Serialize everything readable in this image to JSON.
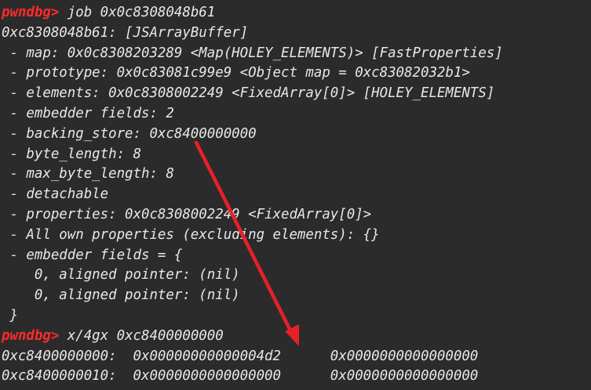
{
  "prompt_label": "pwndbg>",
  "lines": [
    {
      "kind": "prompt",
      "text": " job 0x0c8308048b61"
    },
    {
      "kind": "plain",
      "text": "0xc8308048b61: [JSArrayBuffer]"
    },
    {
      "kind": "plain",
      "text": " - map: 0x0c8308203289 <Map(HOLEY_ELEMENTS)> [FastProperties]"
    },
    {
      "kind": "plain",
      "text": " - prototype: 0x0c83081c99e9 <Object map = 0xc83082032b1>"
    },
    {
      "kind": "plain",
      "text": " - elements: 0x0c8308002249 <FixedArray[0]> [HOLEY_ELEMENTS]"
    },
    {
      "kind": "plain",
      "text": " - embedder fields: 2"
    },
    {
      "kind": "plain",
      "text": " - backing_store: 0xc8400000000"
    },
    {
      "kind": "plain",
      "text": " - byte_length: 8"
    },
    {
      "kind": "plain",
      "text": " - max_byte_length: 8"
    },
    {
      "kind": "plain",
      "text": " - detachable"
    },
    {
      "kind": "plain",
      "text": " - properties: 0x0c8308002249 <FixedArray[0]>"
    },
    {
      "kind": "plain",
      "text": " - All own properties (excluding elements): {}"
    },
    {
      "kind": "plain",
      "text": " - embedder fields = {"
    },
    {
      "kind": "plain",
      "text": "    0, aligned pointer: (nil)"
    },
    {
      "kind": "plain",
      "text": "    0, aligned pointer: (nil)"
    },
    {
      "kind": "plain",
      "text": " }"
    },
    {
      "kind": "prompt",
      "text": " x/4gx 0xc8400000000"
    },
    {
      "kind": "plain",
      "text": "0xc8400000000:  0x00000000000004d2      0x0000000000000000"
    },
    {
      "kind": "plain",
      "text": "0xc8400000010:  0x0000000000000000      0x0000000000000000"
    }
  ],
  "colors": {
    "background": "#2b2b2b",
    "text": "#e8e8e8",
    "prompt": "#ff2b2b",
    "arrow": "#e8202a"
  }
}
